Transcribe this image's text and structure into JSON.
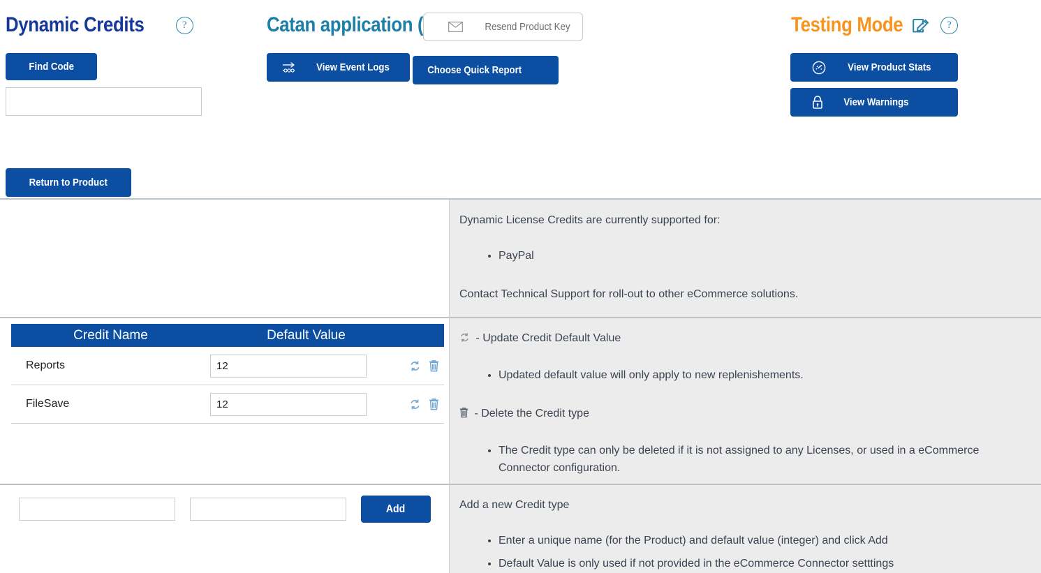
{
  "header": {
    "left": {
      "title": "Dynamic Credits",
      "help_icon": "?",
      "find_code_label": "Find Code",
      "find_code_value": "",
      "find_code_placeholder": "",
      "return_label": "Return to Product"
    },
    "center": {
      "title": "Catan application (                    )",
      "view_event_logs_label": "View Event Logs",
      "choose_quick_report_label": "Choose Quick Report",
      "resend_product_key_label": "Resend Product Key"
    },
    "right": {
      "title": "Testing Mode",
      "edit_icon": "edit-icon",
      "help_icon": "?",
      "view_product_stats_label": "View Product Stats",
      "view_warnings_label": "View Warnings"
    }
  },
  "info_top": {
    "intro": "Dynamic License Credits are currently supported for:",
    "bullets": [
      "PayPal"
    ],
    "footer": "Contact Technical Support for roll-out to other eCommerce solutions."
  },
  "info_mid": {
    "update_heading": "- Update Credit Default Value",
    "update_bullets": [
      "Updated default value will only apply to new replenishements."
    ],
    "delete_heading": "- Delete the Credit type",
    "delete_bullets": [
      "The Credit type can only be deleted if it is not assigned to any Licenses, or used in a eCommerce Connector configuration."
    ]
  },
  "info_bottom": {
    "heading": "Add a new Credit type",
    "bullets": [
      "Enter a unique name (for the Product) and default value (integer) and click Add",
      "Default Value is only used if not provided in the eCommerce Connector setttings"
    ]
  },
  "table": {
    "columns": [
      "Credit Name",
      "Default Value"
    ],
    "rows": [
      {
        "name": "Reports",
        "value": "12"
      },
      {
        "name": "FileSave",
        "value": "12"
      }
    ],
    "row_actions": [
      "refresh-icon",
      "trash-icon"
    ]
  },
  "add_form": {
    "name_value": "",
    "name_placeholder": "",
    "value_value": "",
    "value_placeholder": "",
    "add_label": "Add"
  },
  "colors": {
    "primary_blue": "#0b4ea2",
    "title_dark_blue": "#15389c",
    "title_teal": "#1b7fa8",
    "title_orange": "#f7941e",
    "icon_teal": "#2e86ab",
    "panel_gray": "#ececec"
  }
}
